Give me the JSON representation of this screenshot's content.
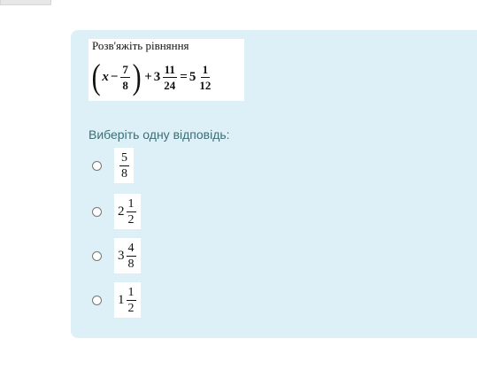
{
  "question": {
    "prompt": "Розв'яжіть рівняння",
    "equation": {
      "variable": "x",
      "minus": "−",
      "frac1_num": "7",
      "frac1_den": "8",
      "plus": "+",
      "whole2": "3",
      "frac2_num": "11",
      "frac2_den": "24",
      "equals": "=",
      "whole3": "5",
      "frac3_num": "1",
      "frac3_den": "12",
      "open_paren": "(",
      "close_paren": ")"
    }
  },
  "instruction": "Виберіть одну відповідь:",
  "options": [
    {
      "whole": "",
      "num": "5",
      "den": "8"
    },
    {
      "whole": "2",
      "num": "1",
      "den": "2"
    },
    {
      "whole": "3",
      "num": "4",
      "den": "8"
    },
    {
      "whole": "1",
      "num": "1",
      "den": "2"
    }
  ]
}
